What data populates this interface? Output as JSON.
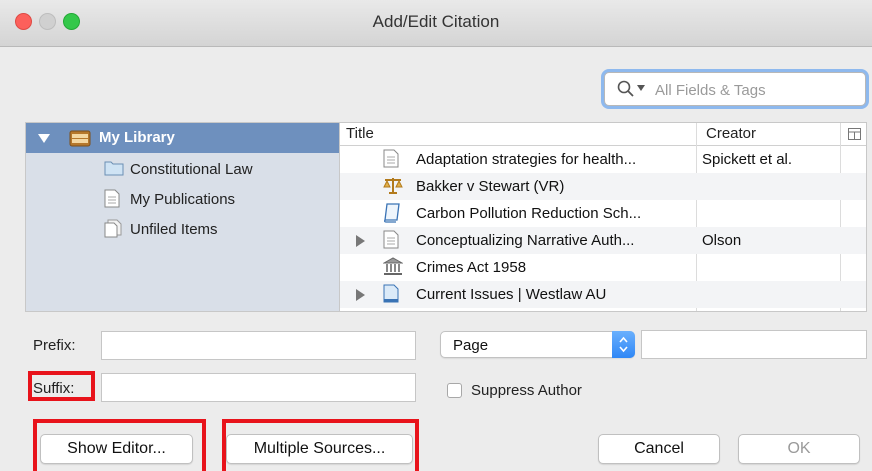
{
  "window": {
    "title": "Add/Edit Citation"
  },
  "search": {
    "placeholder": "All Fields & Tags"
  },
  "sidebar": {
    "library_label": "My Library",
    "collections": [
      {
        "label": "Constitutional Law",
        "icon": "folder-icon"
      },
      {
        "label": "My Publications",
        "icon": "document-icon"
      },
      {
        "label": "Unfiled Items",
        "icon": "unfiled-icon"
      }
    ]
  },
  "items": {
    "columns": {
      "title": "Title",
      "creator": "Creator"
    },
    "rows": [
      {
        "title": "Adaptation strategies for health...",
        "creator": "Spickett et al.",
        "icon": "document-icon",
        "expandable": false
      },
      {
        "title": "Bakker v Stewart (VR)",
        "creator": "",
        "icon": "case-scales-icon",
        "expandable": false
      },
      {
        "title": "Carbon Pollution Reduction Sch...",
        "creator": "",
        "icon": "bill-scroll-icon",
        "expandable": false
      },
      {
        "title": "Conceptualizing Narrative Auth...",
        "creator": "Olson",
        "icon": "document-icon",
        "expandable": true
      },
      {
        "title": "Crimes Act 1958",
        "creator": "",
        "icon": "statute-building-icon",
        "expandable": false
      },
      {
        "title": "Current Issues | Westlaw AU",
        "creator": "",
        "icon": "webpage-icon",
        "expandable": true
      }
    ]
  },
  "form": {
    "prefix_label": "Prefix:",
    "prefix_value": "",
    "suffix_label": "Suffix:",
    "suffix_value": "",
    "locator_type": "Page",
    "locator_value": "",
    "suppress_author_label": "Suppress Author",
    "suppress_author_checked": false
  },
  "buttons": {
    "show_editor": "Show Editor...",
    "multiple_sources": "Multiple Sources...",
    "cancel": "Cancel",
    "ok": "OK"
  },
  "colors": {
    "selection": "#6e90be",
    "annotation": "#e8131b",
    "accent": "#2f87f6"
  }
}
